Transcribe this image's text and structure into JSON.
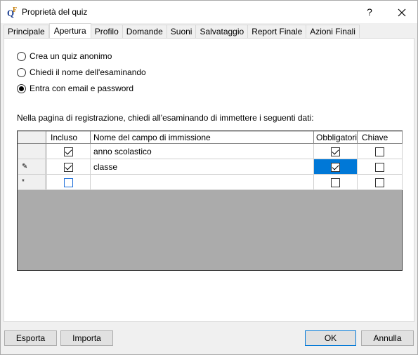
{
  "window": {
    "title": "Proprietà del quiz",
    "help_label": "?",
    "close_label": "✕"
  },
  "tabs": [
    {
      "label": "Principale"
    },
    {
      "label": "Apertura"
    },
    {
      "label": "Profilo"
    },
    {
      "label": "Domande"
    },
    {
      "label": "Suoni"
    },
    {
      "label": "Salvataggio"
    },
    {
      "label": "Report Finale"
    },
    {
      "label": "Azioni Finali"
    }
  ],
  "options": [
    {
      "label": "Crea un quiz anonimo",
      "checked": false
    },
    {
      "label": "Chiedi il nome dell'esaminando",
      "checked": false
    },
    {
      "label": "Entra con email e password",
      "checked": true
    }
  ],
  "instruction": "Nella pagina di registrazione, chiedi all'esaminando di immettere i seguenti dati:",
  "grid": {
    "columns": [
      "Incluso",
      "Nome del campo di immissione",
      "Obbligatoric",
      "Chiave"
    ],
    "rows": [
      {
        "marker": "",
        "incluso": true,
        "nome": "anno scolastico",
        "obbligatorio": true,
        "chiave": false
      },
      {
        "marker": "✎",
        "incluso": true,
        "nome": "classe",
        "obbligatorio": true,
        "chiave": false
      },
      {
        "marker": "*",
        "incluso": false,
        "nome": "",
        "obbligatorio": false,
        "chiave": false
      }
    ]
  },
  "buttons": {
    "esporta": "Esporta",
    "importa": "Importa",
    "ok": "OK",
    "annulla": "Annulla"
  },
  "colors": {
    "selection": "#0078d7",
    "empty_area": "#ababab"
  }
}
